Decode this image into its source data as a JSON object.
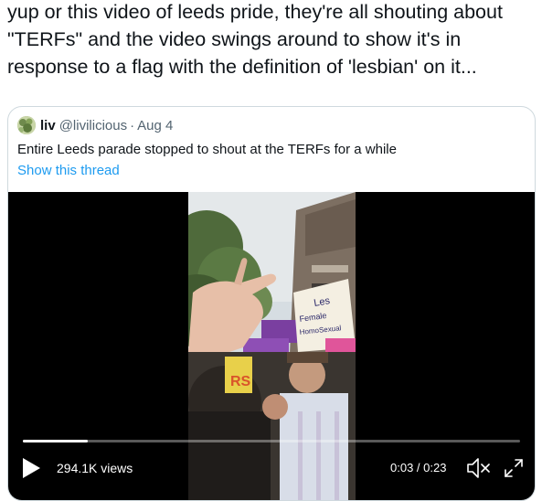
{
  "tweet": {
    "text": "yup or this video of leeds pride, they're all shouting about \"TERFs\" and the video swings around to show it's in response to a flag with the definition of 'lesbian' on it..."
  },
  "quoted_tweet": {
    "display_name": "liv",
    "handle": "@livilicious",
    "separator": "·",
    "date": "Aug 4",
    "text": "Entire Leeds parade stopped to shout at the TERFs for a while",
    "show_thread_label": "Show this thread"
  },
  "video": {
    "views": "294.1K views",
    "time": "0:03 / 0:23",
    "progress": 0.13,
    "icons": {
      "play": "play-icon",
      "mute": "muted-speaker-icon",
      "fullscreen": "fullscreen-icon"
    },
    "sign_text": "Les Female Homosexual"
  },
  "colors": {
    "link": "#1d9bf0",
    "secondary_text": "#536471",
    "border": "#cfd9de",
    "video_bg": "#000000"
  }
}
